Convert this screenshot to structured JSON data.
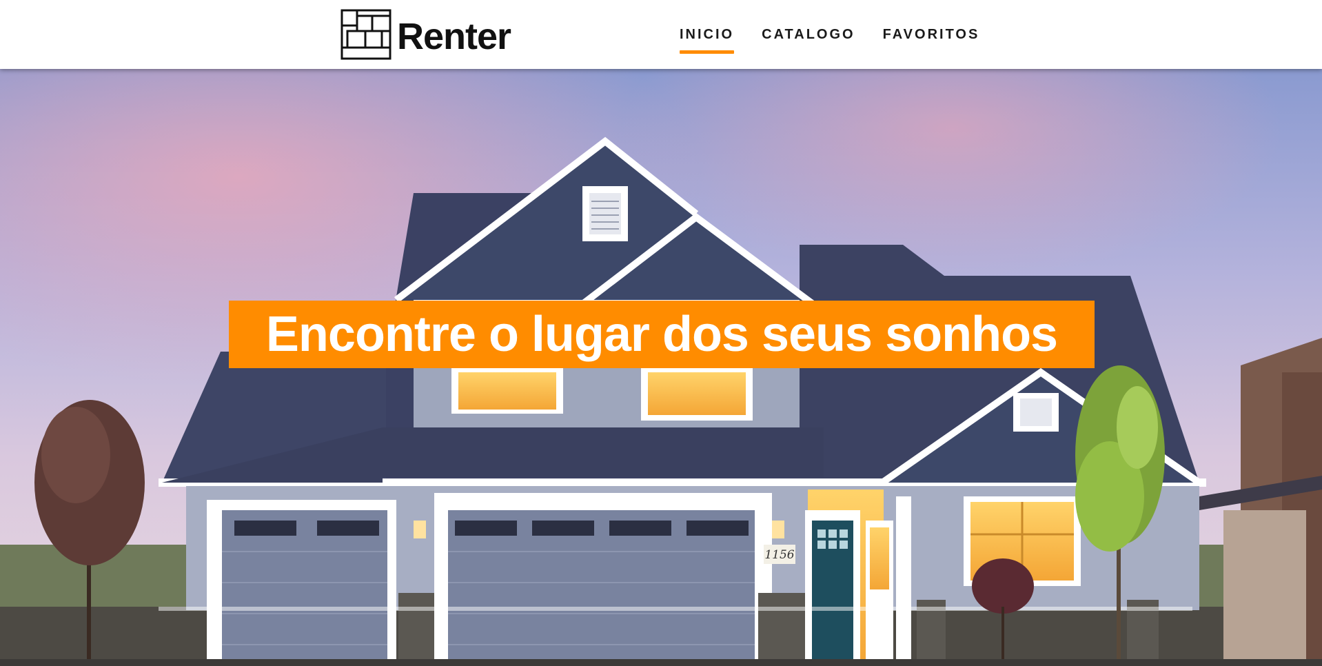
{
  "brand": {
    "name": "Renter",
    "logo_icon": "window-grid-icon"
  },
  "nav": {
    "items": [
      {
        "label": "INICIO",
        "active": true
      },
      {
        "label": "CATALOGO",
        "active": false
      },
      {
        "label": "FAVORITOS",
        "active": false
      }
    ]
  },
  "hero": {
    "headline": "Encontre o lugar dos seus sonhos",
    "house_number": "1156",
    "image": "house-at-dusk"
  },
  "colors": {
    "accent": "#ff8c00",
    "header_bg": "#ffffff",
    "text_dark": "#111111",
    "headline_text": "#ffffff"
  }
}
